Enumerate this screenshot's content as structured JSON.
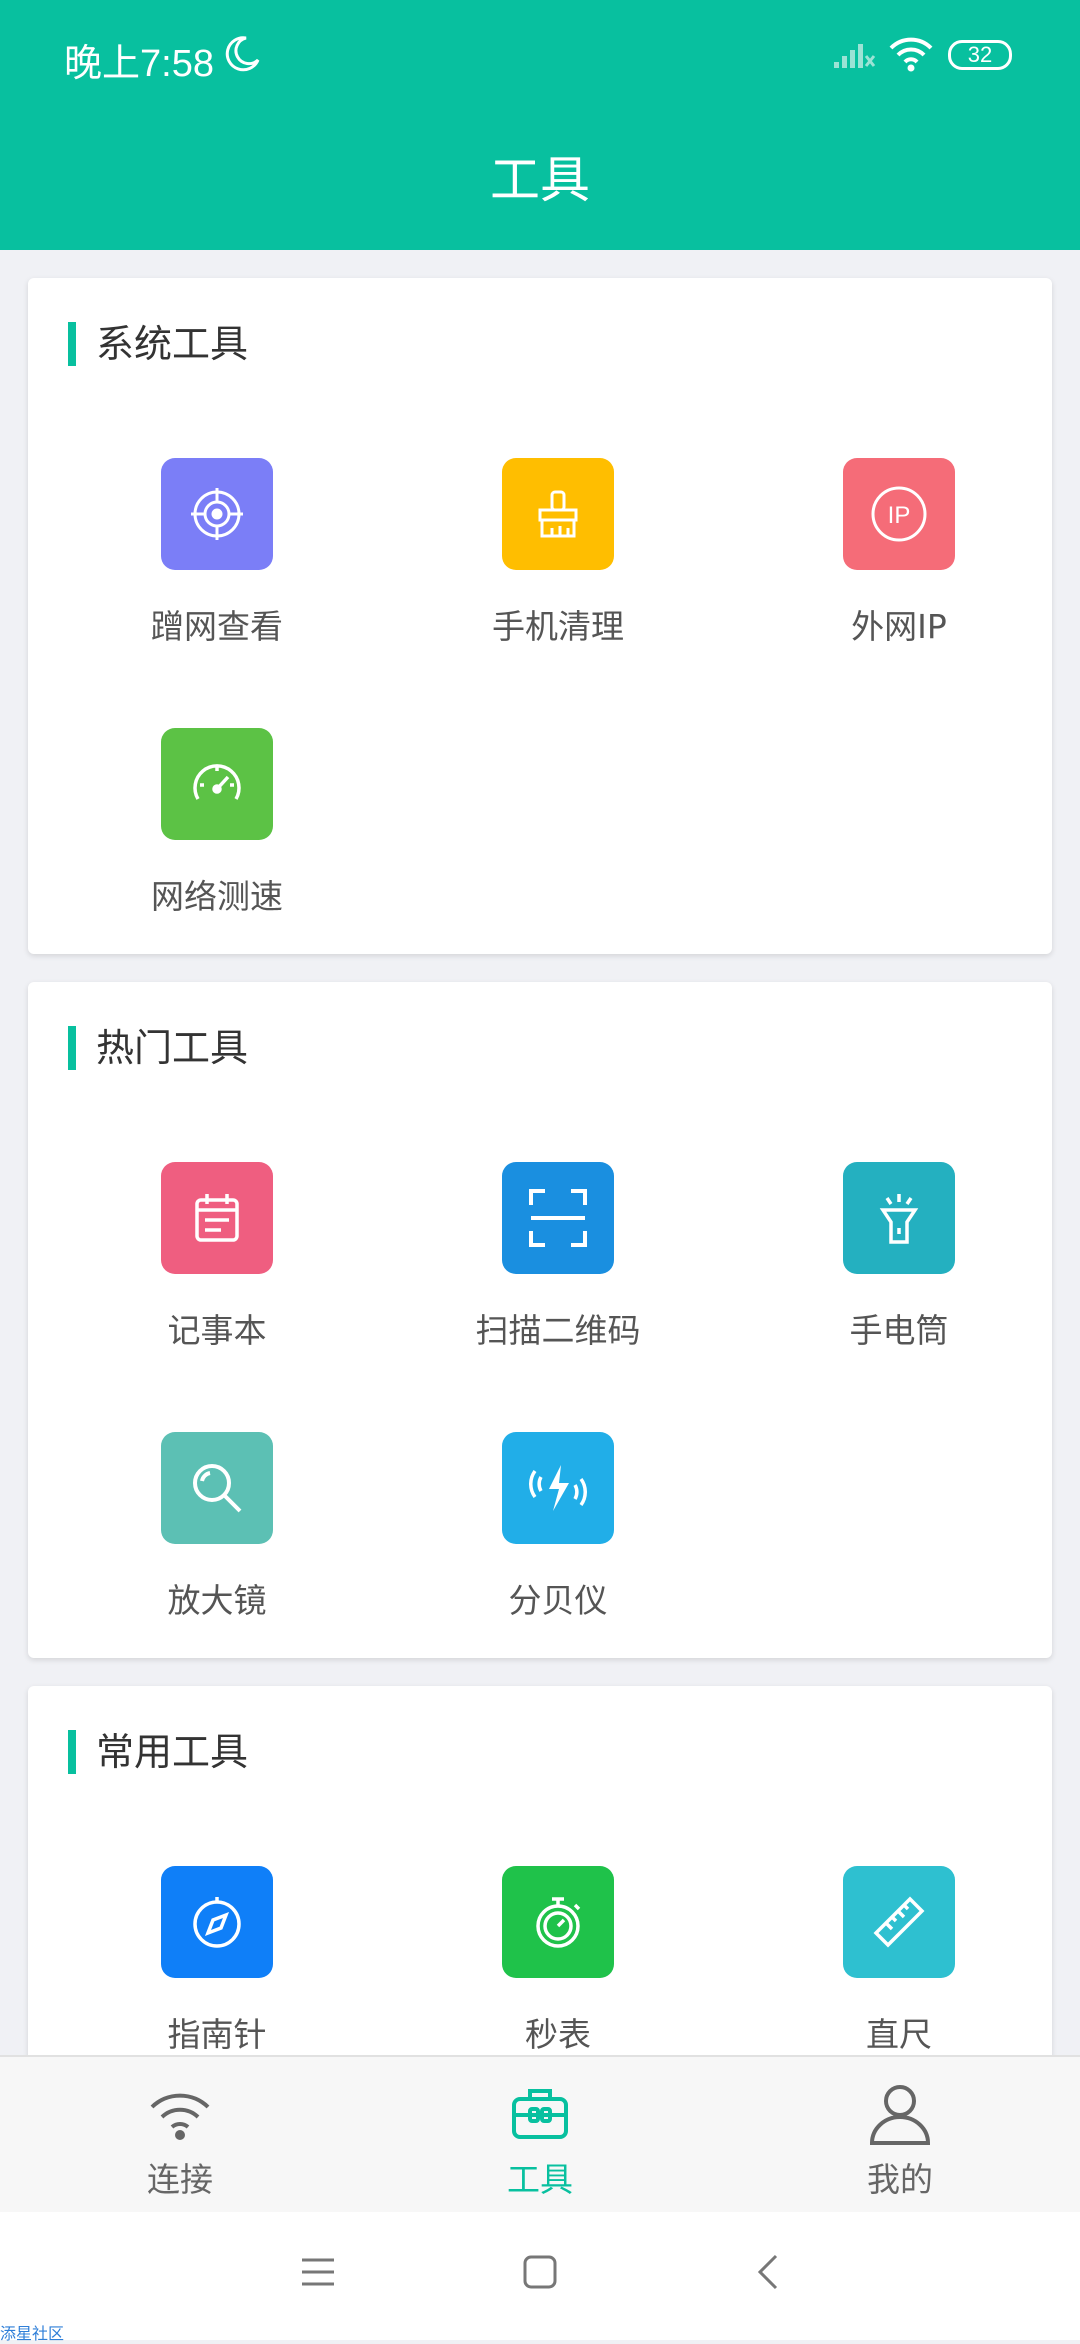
{
  "status": {
    "time": "晚上7:58",
    "battery": "32"
  },
  "header": {
    "title": "工具"
  },
  "sections": [
    {
      "title": "系统工具",
      "tools": [
        {
          "label": "蹭网查看",
          "color": "#7b7ef7",
          "icon": "target-icon"
        },
        {
          "label": "手机清理",
          "color": "#ffbe00",
          "icon": "broom-icon"
        },
        {
          "label": "外网IP",
          "color": "#f56c78",
          "icon": "ip-icon",
          "icon_text": "IP"
        },
        {
          "label": "网络测速",
          "color": "#5cc245",
          "icon": "speedometer-icon"
        }
      ]
    },
    {
      "title": "热门工具",
      "tools": [
        {
          "label": "记事本",
          "color": "#ef5e80",
          "icon": "calendar-icon"
        },
        {
          "label": "扫描二维码",
          "color": "#1a8fe0",
          "icon": "scan-icon"
        },
        {
          "label": "手电筒",
          "color": "#24b0c0",
          "icon": "flashlight-icon"
        },
        {
          "label": "放大镜",
          "color": "#5cc0b4",
          "icon": "magnifier-icon"
        },
        {
          "label": "分贝仪",
          "color": "#21aee8",
          "icon": "decibel-icon"
        }
      ]
    },
    {
      "title": "常用工具",
      "tools": [
        {
          "label": "指南针",
          "color": "#0f7ff8",
          "icon": "compass-icon"
        },
        {
          "label": "秒表",
          "color": "#1fc24a",
          "icon": "stopwatch-icon"
        },
        {
          "label": "直尺",
          "color": "#2ec0d0",
          "icon": "ruler-icon"
        }
      ]
    }
  ],
  "tabs": [
    {
      "label": "连接",
      "icon": "wifi-icon",
      "active": false
    },
    {
      "label": "工具",
      "icon": "toolbox-icon",
      "active": true
    },
    {
      "label": "我的",
      "icon": "user-icon",
      "active": false
    }
  ],
  "colors": {
    "accent": "#08c09f"
  },
  "watermark": "添星社区"
}
